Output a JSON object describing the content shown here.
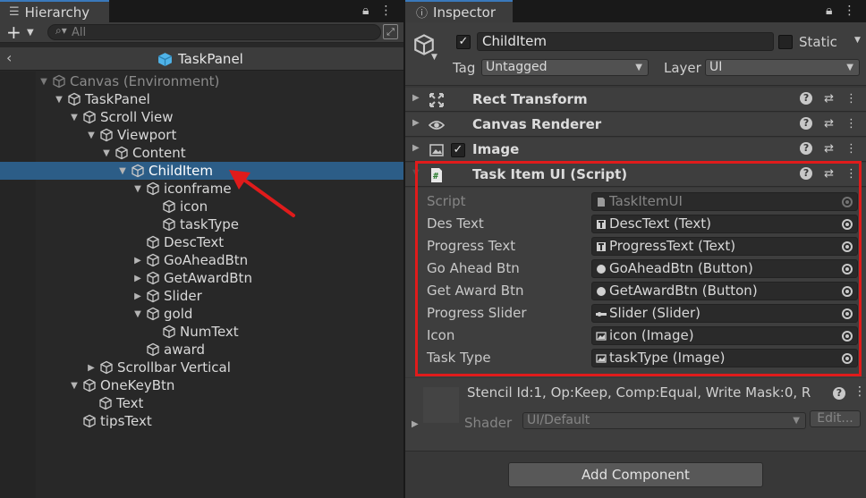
{
  "hierarchy": {
    "tab_label": "Hierarchy",
    "search_placeholder": "All",
    "prefab_title": "TaskPanel",
    "rows": [
      {
        "label": "Canvas (Environment)"
      },
      {
        "label": "TaskPanel"
      },
      {
        "label": "Scroll View"
      },
      {
        "label": "Viewport"
      },
      {
        "label": "Content"
      },
      {
        "label": "ChildItem"
      },
      {
        "label": "iconframe"
      },
      {
        "label": "icon"
      },
      {
        "label": "taskType"
      },
      {
        "label": "DescText"
      },
      {
        "label": "GoAheadBtn"
      },
      {
        "label": "GetAwardBtn"
      },
      {
        "label": "Slider"
      },
      {
        "label": "gold"
      },
      {
        "label": "NumText"
      },
      {
        "label": "award"
      },
      {
        "label": "Scrollbar Vertical"
      },
      {
        "label": "OneKeyBtn"
      },
      {
        "label": "Text"
      },
      {
        "label": "tipsText"
      }
    ]
  },
  "inspector": {
    "tab_label": "Inspector",
    "object_name": "ChildItem",
    "static_label": "Static",
    "tag_label": "Tag",
    "tag_value": "Untagged",
    "layer_label": "Layer",
    "layer_value": "UI",
    "components": {
      "rect_transform": "Rect Transform",
      "canvas_renderer": "Canvas Renderer",
      "image": "Image",
      "script": "Task Item UI (Script)"
    },
    "script_props": [
      {
        "label": "Script",
        "value": "TaskItemUI"
      },
      {
        "label": "Des Text",
        "value": "DescText (Text)"
      },
      {
        "label": "Progress Text",
        "value": "ProgressText (Text)"
      },
      {
        "label": "Go Ahead Btn",
        "value": "GoAheadBtn (Button)"
      },
      {
        "label": "Get Award Btn",
        "value": "GetAwardBtn (Button)"
      },
      {
        "label": "Progress Slider",
        "value": "Slider (Slider)"
      },
      {
        "label": "Icon",
        "value": "icon (Image)"
      },
      {
        "label": "Task Type",
        "value": "taskType (Image)"
      }
    ],
    "material": {
      "stencil_text": "Stencil Id:1, Op:Keep, Comp:Equal, Write Mask:0, R",
      "shader_label": "Shader",
      "shader_value": "UI/Default",
      "edit_label": "Edit..."
    },
    "add_component_label": "Add Component"
  },
  "colors": {
    "selection": "#2c5d87",
    "highlight_box": "#e01b1b",
    "tab_accent": "#3a79bb"
  }
}
